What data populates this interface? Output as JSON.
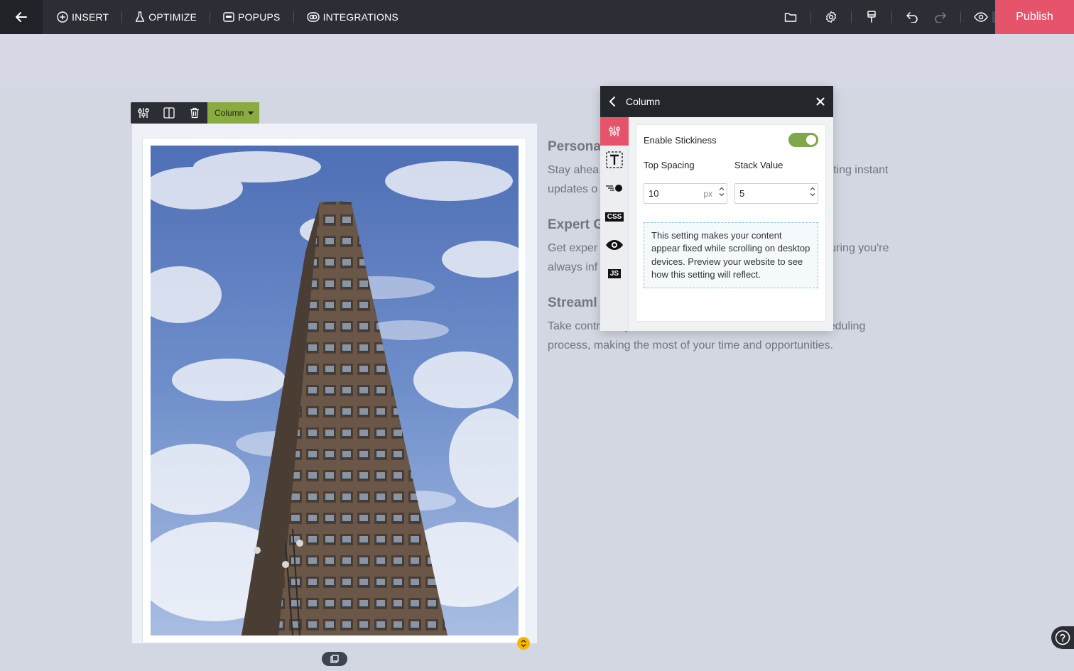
{
  "topbar": {
    "menu": [
      {
        "label": "INSERT",
        "icon": "plus-circle-icon"
      },
      {
        "label": "OPTIMIZE",
        "icon": "flask-icon"
      },
      {
        "label": "POPUPS",
        "icon": "popup-window-icon"
      },
      {
        "label": "INTEGRATIONS",
        "icon": "link-icon"
      }
    ],
    "publish_label": "Publish"
  },
  "column_toolbar": {
    "label": "Column"
  },
  "features": [
    {
      "title": "Personalized Property Alerts",
      "text": "Stay ahead of the competition by receiving instant updates on properties matching instant updates on new listings."
    },
    {
      "title": "Expert Guidance",
      "text": "Get expert advice and insights from our team, ensuring you're always informed."
    },
    {
      "title": "Streamlined Property Scheduling",
      "text": "Take control of your home search with a hassle-free scheduling process, making the most of your time and opportunities."
    }
  ],
  "visible_text": {
    "feat1_title": "Persona",
    "feat1_line1_start": "Stay ahea",
    "feat1_line1_end": "ting instant",
    "feat1_line2": "updates o",
    "feat2_title": "Expert G",
    "feat2_line1_start": "Get exper",
    "feat2_line1_end": "uring you're",
    "feat2_line2": "always inf",
    "feat3_title": "Streaml",
    "feat3_line1": "Take control of your home search with a hassle-free scheduling",
    "feat3_line2": "process, making the most of your time and opportunities."
  },
  "panel": {
    "title": "Column",
    "enable_stickiness_label": "Enable Stickiness",
    "stickiness_enabled": true,
    "top_spacing_label": "Top Spacing",
    "top_spacing_value": "10",
    "top_spacing_unit": "px",
    "stack_value_label": "Stack Value",
    "stack_value": "5",
    "info_text": "This setting makes your content appear fixed while scrolling on desktop devices. Preview your website to see how this setting will reflect.",
    "side_tabs": [
      "sliders-icon",
      "text-icon",
      "effects-icon",
      "CSS",
      "eye-icon",
      "JS"
    ],
    "css_badge": "CSS",
    "js_badge": "JS"
  },
  "colors": {
    "topbar_bg": "#2b2e34",
    "publish_bg": "#e6546b",
    "column_label_bg": "#8aaa42",
    "toggle_on": "#7ea64b",
    "canvas_bg": "#d2d7e2"
  }
}
